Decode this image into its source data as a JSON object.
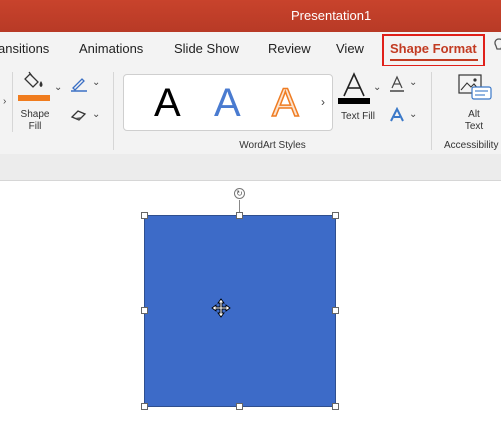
{
  "window": {
    "title": "Presentation1"
  },
  "tabs": [
    {
      "label": "ansitions"
    },
    {
      "label": "Animations"
    },
    {
      "label": "Slide Show"
    },
    {
      "label": "Review"
    },
    {
      "label": "View"
    },
    {
      "label": "Shape Format"
    }
  ],
  "ribbon": {
    "shape_fill_label_1": "Shape",
    "shape_fill_label_2": "Fill",
    "wordart_styles": {
      "label": "WordArt Styles",
      "letters": [
        "A",
        "A",
        "A"
      ]
    },
    "text_fill_label": "Text Fill",
    "alt_text_label_1": "Alt",
    "alt_text_label_2": "Text",
    "accessibility_label": "Accessibility"
  },
  "colors": {
    "titlebar": "#c23b22",
    "shape_fill": "#3d6bc8",
    "highlight_box": "#e0201a",
    "fill_swatch": "#f07c1e"
  }
}
